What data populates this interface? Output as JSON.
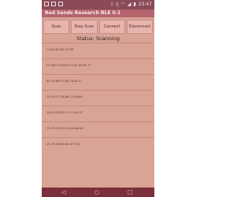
{
  "status_bar": {
    "left_icons": [
      "notification-icon",
      "notification-icon",
      "notification-icon"
    ],
    "right_icons": [
      "bluetooth-icon",
      "vibrate-icon",
      "wifi-icon",
      "signal-icon",
      "battery-icon"
    ],
    "time": "23:47"
  },
  "app_bar": {
    "title": "Red Sands Research BLE 0.1"
  },
  "toolbar": {
    "buttons": [
      {
        "label": "Scan"
      },
      {
        "label": "Stop Scan"
      },
      {
        "label": "Connect"
      },
      {
        "label": "Disconnect"
      }
    ]
  },
  "status": {
    "text": "Status: Scanning"
  },
  "devices": [
    {
      "text": "C4:52:A0:B3:12:FB"
    },
    {
      "text": "F2:58:F1:D3:0E:C3 5C:AF:BE 7T"
    },
    {
      "text": "60:19:8B:97:8D:7B:A1:E"
    },
    {
      "text": "79:3D:F1:2B:8B:12:A8:65"
    },
    {
      "text": "28:E2:03:D5:12:77:A0:7E"
    },
    {
      "text": "79:79:C9:D3:22:A8:A8:9D"
    },
    {
      "text": "20:79:4D:09:D3:4F:7C6"
    }
  ],
  "nav_bar": {
    "back": "◁",
    "home": "○",
    "recent": "□"
  }
}
